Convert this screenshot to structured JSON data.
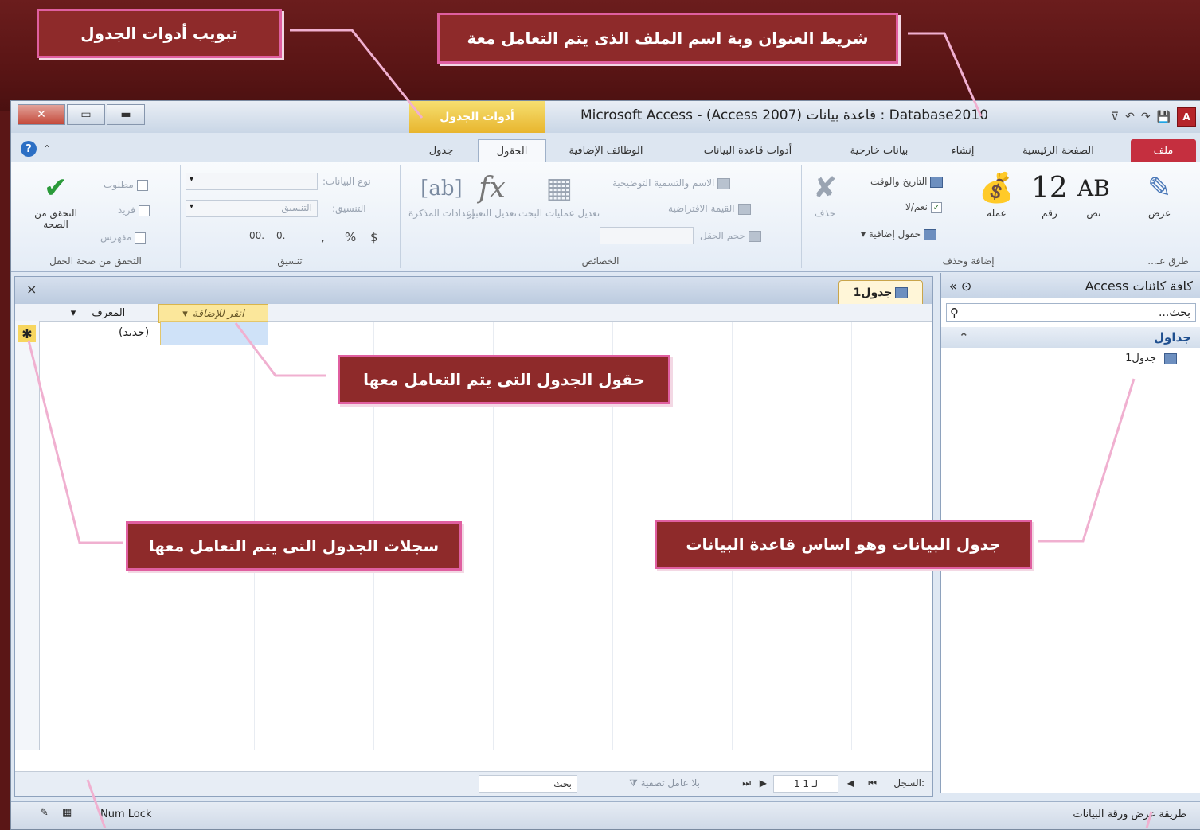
{
  "callouts": {
    "table_tools_tab": "تبويب أدوات الجدول",
    "title_bar": "شريط العنوان وبة اسم الملف الذى يتم التعامل معة",
    "table_fields": "حقول الجدول التى يتم التعامل معها",
    "table_records": "سجلات الجدول التى يتم التعامل معها",
    "data_table": "جدول البيانات وهو اساس قاعدة البيانات"
  },
  "window": {
    "title": "Microsoft Access - (Access 2007) قاعدة بيانات : Database2010",
    "context_tab": "أدوات الجدول",
    "app_icon": "A"
  },
  "tabs": [
    "ملف",
    "الصفحة الرئيسية",
    "إنشاء",
    "بيانات خارجية",
    "أدوات قاعدة البيانات",
    "الوظائف الإضافية",
    "الحقول",
    "جدول"
  ],
  "ribbon": {
    "views": {
      "label": "عرض",
      "group": "طرق عـ..."
    },
    "add_delete": {
      "text": "نص",
      "text_icon": "AB",
      "number": "رقم",
      "number_icon": "12",
      "currency": "عملة",
      "datetime": "التاريخ والوقت",
      "yesno": "نعم/لا",
      "more_fields": "حقول إضافية",
      "delete": "حذف",
      "group": "إضافة وحذف"
    },
    "properties": {
      "name_caption": "الاسم والتسمية التوضيحية",
      "default_value": "القيمة الافتراضية",
      "field_size": "حجم الحقل",
      "modify_lookups": "تعديل عمليات البحث",
      "modify_expression": "تعديل التعبير",
      "memo_settings": "إعدادات المذكرة",
      "group": "الخصائص"
    },
    "formatting": {
      "data_type": "نوع البيانات:",
      "format": "التنسيق:",
      "format_value": "التنسيق",
      "dollar": "$",
      "percent": "%",
      "comma": ",",
      "inc_dec": ".00",
      "dec_dec": ".0",
      "group": "تنسيق"
    },
    "validation": {
      "required": "مطلوب",
      "unique": "فريد",
      "indexed": "مفهرس",
      "validation_btn": "التحقق من الصحة",
      "group": "التحقق من صحة الحقل"
    }
  },
  "nav": {
    "title": "كافة كائنات Access",
    "search": "بحث...",
    "group": "جداول",
    "item": "جدول1"
  },
  "doc": {
    "tab": "جدول1",
    "close": "×",
    "col_id": "المعرف",
    "col_add": "انقر للإضافة",
    "new_value": "(جديد)",
    "record_label": "السجل:",
    "record_pos": "1 لـ 1",
    "no_filter": "بلا عامل تصفية",
    "search": "بحث"
  },
  "status": {
    "left": "طريقة عرض ورقة البيانات",
    "numlock": "Num Lock"
  }
}
